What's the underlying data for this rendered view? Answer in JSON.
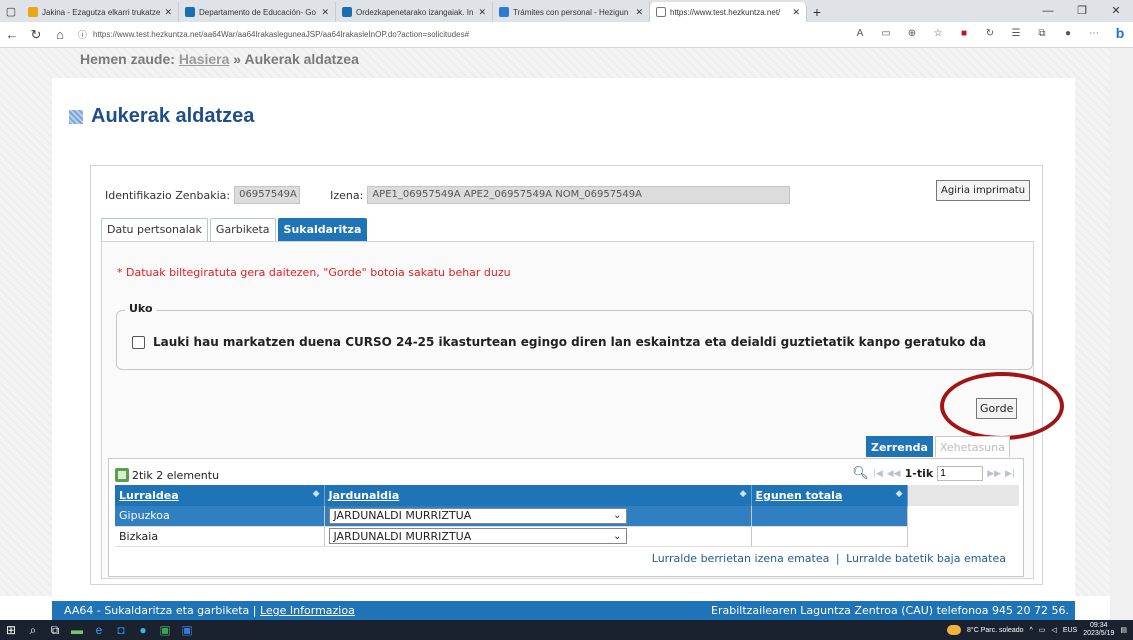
{
  "browser": {
    "tabs": [
      {
        "title": "Jakina - Ezagutza elkarri trukatze",
        "color": "#e6a817"
      },
      {
        "title": "Departamento de Educación- Go",
        "color": "#1a6fb3"
      },
      {
        "title": "Ordezkapenetarako izangaiak. In",
        "color": "#1a6fb3"
      },
      {
        "title": "Trámites con personal - Hezigun",
        "color": "#2d7ad6"
      },
      {
        "title": "https://www.test.hezkuntza.net/",
        "color": "#777777"
      }
    ],
    "url": "https://www.test.hezkuntza.net/aa64War/aa64IrakasleguneaJSP/aa64IrakasleInOP.do?action=solicitudes#"
  },
  "breadcrumb": {
    "prefix": "Hemen zaude:",
    "home": "Hasiera",
    "separator": "»",
    "current": "Aukerak aldatzea"
  },
  "page_title": "Aukerak aldatzea",
  "identity": {
    "id_label": "Identifikazio Zenbakia:",
    "id_value": "06957549A",
    "name_label": "Izena:",
    "name_value": "APE1_06957549A APE2_06957549A NOM_06957549A",
    "print_button": "Agiria imprimatu"
  },
  "tabs": [
    "Datu pertsonalak",
    "Garbiketa",
    "Sukaldaritza"
  ],
  "active_tab": "Sukaldaritza",
  "warning": "* Datuak biltegiratuta gera daitezen, \"Gorde\" botoia sakatu behar duzu",
  "fieldset": {
    "legend": "Uko",
    "checkbox_label": "Lauki hau markatzen duena CURSO 24-25 ikasturtean egingo diren lan eskaintza eta deialdi guztietatik kanpo geratuko da",
    "checked": false
  },
  "save_button": "Gorde",
  "subtabs": [
    "Zerrenda",
    "Xehetasuna"
  ],
  "grid": {
    "count_text": "2tik 2 elementu",
    "pager_text": "1-tik",
    "page_input": "1",
    "columns": [
      "Lurraldea",
      "Jardunaldia",
      "Egunen totala"
    ],
    "rows": [
      {
        "lurraldea": "Gipuzkoa",
        "jardunaldia": "JARDUNALDI MURRIZTUA",
        "egunak": ""
      },
      {
        "lurraldea": "Bizkaia",
        "jardunaldia": "JARDUNALDI MURRIZTUA",
        "egunak": ""
      }
    ],
    "link_register": "Lurralde berrietan izena ematea",
    "link_unregister": "Lurralde batetik baja ematea"
  },
  "footer": {
    "left_prefix": "AA64 - Sukaldaritza eta garbiketa |",
    "left_link": "Lege Informazioa",
    "right": "Erabiltzailearen Laguntza Zentroa (CAU) telefonoa 945 20 72 56."
  },
  "taskbar": {
    "weather": "8°C Parc. soleado",
    "lang": "EUS",
    "time": "09:34",
    "date": "2023/5/19"
  }
}
